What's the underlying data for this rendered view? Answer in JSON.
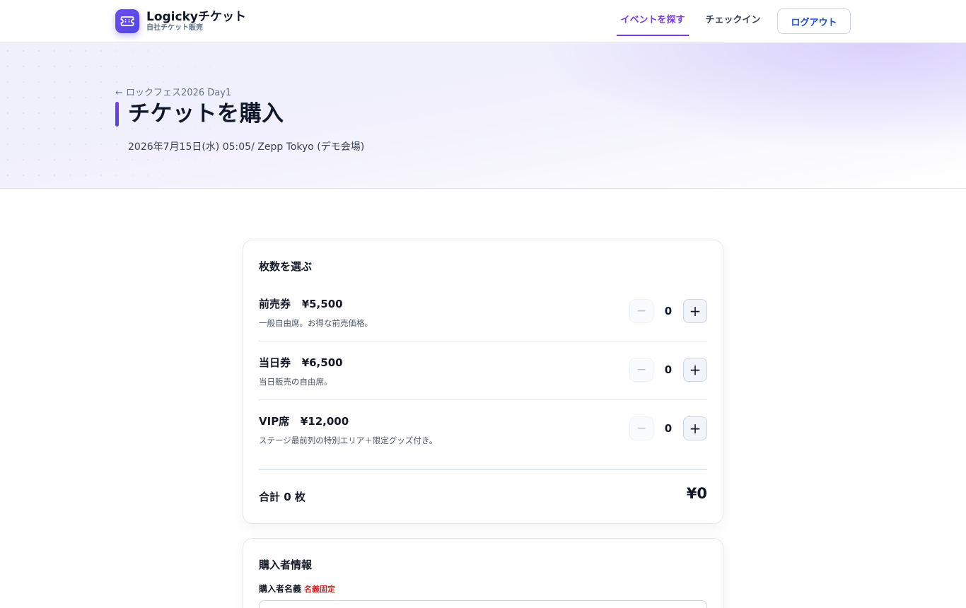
{
  "header": {
    "brand_name": "Logickyチケット",
    "brand_sub": "自社チケット販売",
    "nav": [
      {
        "label": "イベントを探す",
        "active": true
      },
      {
        "label": "チェックイン",
        "active": false
      }
    ],
    "logout_label": "ログアウト"
  },
  "hero": {
    "back_link": "← ロックフェス2026 Day1",
    "title": "チケットを購入",
    "meta": "2026年7月15日(水) 05:05/ Zepp Tokyo (デモ会場)"
  },
  "quantity": {
    "title": "枚数を選ぶ",
    "tickets": [
      {
        "name": "前売券",
        "price": "¥5,500",
        "desc": "一般自由席。お得な前売価格。",
        "qty": "0"
      },
      {
        "name": "当日券",
        "price": "¥6,500",
        "desc": "当日販売の自由席。",
        "qty": "0"
      },
      {
        "name": "VIP席",
        "price": "¥12,000",
        "desc": "ステージ最前列の特別エリア＋限定グッズ付き。",
        "qty": "0"
      }
    ],
    "minus_symbol": "−",
    "plus_symbol": "+",
    "total_label": "合計 0 枚",
    "total_amount": "¥0"
  },
  "buyer": {
    "title": "購入者情報",
    "name_label": "購入者名義",
    "name_fixed_badge": "名義固定",
    "name_value": ""
  },
  "colors": {
    "accent": "#7c3aed",
    "brand": "#4f46e5",
    "logout_text": "#1d4ed8",
    "fixed_badge": "#dc2626"
  },
  "icons": {
    "brand_logo": "ticket-icon"
  }
}
